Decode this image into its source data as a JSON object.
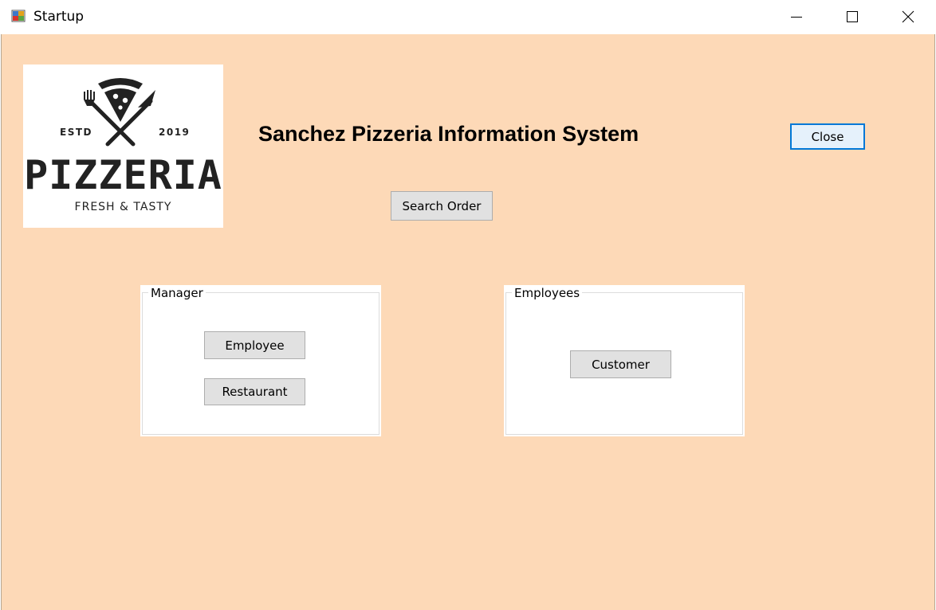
{
  "window": {
    "title": "Startup",
    "controls": {
      "minimize": "minimize-icon",
      "maximize": "maximize-icon",
      "close": "close-icon"
    }
  },
  "logo": {
    "estd": "ESTD",
    "year": "2019",
    "name": "PIZZERIA",
    "tagline": "FRESH & TASTY"
  },
  "heading": "Sanchez Pizzeria Information System",
  "buttons": {
    "close": "Close",
    "search_order": "Search Order"
  },
  "groups": {
    "manager": {
      "label": "Manager",
      "buttons": {
        "employee": "Employee",
        "restaurant": "Restaurant"
      }
    },
    "employees": {
      "label": "Employees",
      "buttons": {
        "customer": "Customer"
      }
    }
  },
  "colors": {
    "background": "#fdd9b7",
    "focus_border": "#0078d7",
    "button_face": "#e1e1e1"
  }
}
